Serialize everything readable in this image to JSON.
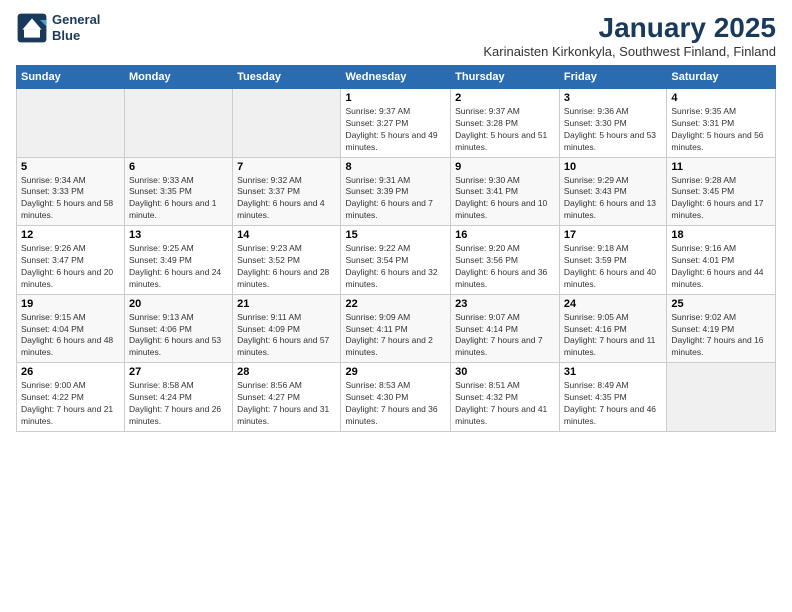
{
  "logo": {
    "line1": "General",
    "line2": "Blue"
  },
  "title": "January 2025",
  "subtitle": "Karinaisten Kirkonkyla, Southwest Finland, Finland",
  "days_of_week": [
    "Sunday",
    "Monday",
    "Tuesday",
    "Wednesday",
    "Thursday",
    "Friday",
    "Saturday"
  ],
  "weeks": [
    [
      {
        "day": "",
        "info": ""
      },
      {
        "day": "",
        "info": ""
      },
      {
        "day": "",
        "info": ""
      },
      {
        "day": "1",
        "info": "Sunrise: 9:37 AM\nSunset: 3:27 PM\nDaylight: 5 hours and 49 minutes."
      },
      {
        "day": "2",
        "info": "Sunrise: 9:37 AM\nSunset: 3:28 PM\nDaylight: 5 hours and 51 minutes."
      },
      {
        "day": "3",
        "info": "Sunrise: 9:36 AM\nSunset: 3:30 PM\nDaylight: 5 hours and 53 minutes."
      },
      {
        "day": "4",
        "info": "Sunrise: 9:35 AM\nSunset: 3:31 PM\nDaylight: 5 hours and 56 minutes."
      }
    ],
    [
      {
        "day": "5",
        "info": "Sunrise: 9:34 AM\nSunset: 3:33 PM\nDaylight: 5 hours and 58 minutes."
      },
      {
        "day": "6",
        "info": "Sunrise: 9:33 AM\nSunset: 3:35 PM\nDaylight: 6 hours and 1 minute."
      },
      {
        "day": "7",
        "info": "Sunrise: 9:32 AM\nSunset: 3:37 PM\nDaylight: 6 hours and 4 minutes."
      },
      {
        "day": "8",
        "info": "Sunrise: 9:31 AM\nSunset: 3:39 PM\nDaylight: 6 hours and 7 minutes."
      },
      {
        "day": "9",
        "info": "Sunrise: 9:30 AM\nSunset: 3:41 PM\nDaylight: 6 hours and 10 minutes."
      },
      {
        "day": "10",
        "info": "Sunrise: 9:29 AM\nSunset: 3:43 PM\nDaylight: 6 hours and 13 minutes."
      },
      {
        "day": "11",
        "info": "Sunrise: 9:28 AM\nSunset: 3:45 PM\nDaylight: 6 hours and 17 minutes."
      }
    ],
    [
      {
        "day": "12",
        "info": "Sunrise: 9:26 AM\nSunset: 3:47 PM\nDaylight: 6 hours and 20 minutes."
      },
      {
        "day": "13",
        "info": "Sunrise: 9:25 AM\nSunset: 3:49 PM\nDaylight: 6 hours and 24 minutes."
      },
      {
        "day": "14",
        "info": "Sunrise: 9:23 AM\nSunset: 3:52 PM\nDaylight: 6 hours and 28 minutes."
      },
      {
        "day": "15",
        "info": "Sunrise: 9:22 AM\nSunset: 3:54 PM\nDaylight: 6 hours and 32 minutes."
      },
      {
        "day": "16",
        "info": "Sunrise: 9:20 AM\nSunset: 3:56 PM\nDaylight: 6 hours and 36 minutes."
      },
      {
        "day": "17",
        "info": "Sunrise: 9:18 AM\nSunset: 3:59 PM\nDaylight: 6 hours and 40 minutes."
      },
      {
        "day": "18",
        "info": "Sunrise: 9:16 AM\nSunset: 4:01 PM\nDaylight: 6 hours and 44 minutes."
      }
    ],
    [
      {
        "day": "19",
        "info": "Sunrise: 9:15 AM\nSunset: 4:04 PM\nDaylight: 6 hours and 48 minutes."
      },
      {
        "day": "20",
        "info": "Sunrise: 9:13 AM\nSunset: 4:06 PM\nDaylight: 6 hours and 53 minutes."
      },
      {
        "day": "21",
        "info": "Sunrise: 9:11 AM\nSunset: 4:09 PM\nDaylight: 6 hours and 57 minutes."
      },
      {
        "day": "22",
        "info": "Sunrise: 9:09 AM\nSunset: 4:11 PM\nDaylight: 7 hours and 2 minutes."
      },
      {
        "day": "23",
        "info": "Sunrise: 9:07 AM\nSunset: 4:14 PM\nDaylight: 7 hours and 7 minutes."
      },
      {
        "day": "24",
        "info": "Sunrise: 9:05 AM\nSunset: 4:16 PM\nDaylight: 7 hours and 11 minutes."
      },
      {
        "day": "25",
        "info": "Sunrise: 9:02 AM\nSunset: 4:19 PM\nDaylight: 7 hours and 16 minutes."
      }
    ],
    [
      {
        "day": "26",
        "info": "Sunrise: 9:00 AM\nSunset: 4:22 PM\nDaylight: 7 hours and 21 minutes."
      },
      {
        "day": "27",
        "info": "Sunrise: 8:58 AM\nSunset: 4:24 PM\nDaylight: 7 hours and 26 minutes."
      },
      {
        "day": "28",
        "info": "Sunrise: 8:56 AM\nSunset: 4:27 PM\nDaylight: 7 hours and 31 minutes."
      },
      {
        "day": "29",
        "info": "Sunrise: 8:53 AM\nSunset: 4:30 PM\nDaylight: 7 hours and 36 minutes."
      },
      {
        "day": "30",
        "info": "Sunrise: 8:51 AM\nSunset: 4:32 PM\nDaylight: 7 hours and 41 minutes."
      },
      {
        "day": "31",
        "info": "Sunrise: 8:49 AM\nSunset: 4:35 PM\nDaylight: 7 hours and 46 minutes."
      },
      {
        "day": "",
        "info": ""
      }
    ]
  ]
}
